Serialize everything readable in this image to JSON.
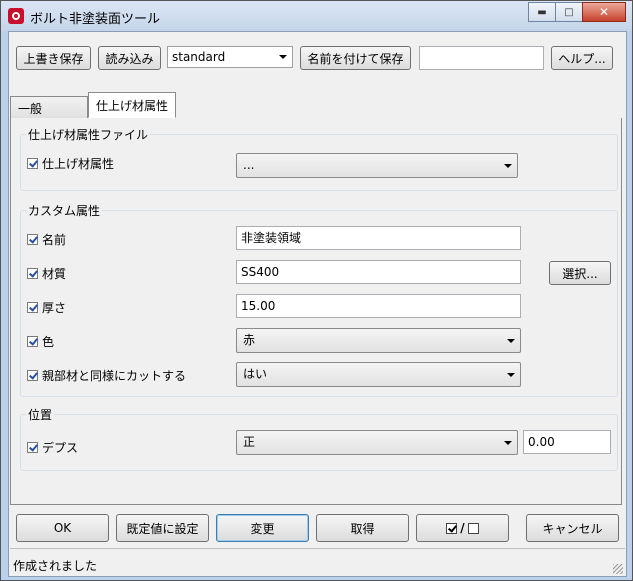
{
  "window": {
    "title": "ボルト非塗装面ツール"
  },
  "toolbar": {
    "save_label": "上書き保存",
    "load_label": "読み込み",
    "preset_value": "standard",
    "save_as_label": "名前を付けて保存",
    "save_as_name": "",
    "help_label": "ヘルプ..."
  },
  "tabs": [
    {
      "label": "一般"
    },
    {
      "label": "仕上げ材属性"
    }
  ],
  "finish_file": {
    "group_title": "仕上げ材属性ファイル",
    "label": "仕上げ材属性",
    "value": "..."
  },
  "custom": {
    "group_title": "カスタム属性",
    "name_label": "名前",
    "name_value": "非塗装領域",
    "material_label": "材質",
    "material_value": "SS400",
    "select_label": "選択...",
    "thickness_label": "厚さ",
    "thickness_value": "15.00",
    "color_label": "色",
    "color_value": "赤",
    "cut_label": "親部材と同様にカットする",
    "cut_value": "はい"
  },
  "position": {
    "group_title": "位置",
    "depth_label": "デプス",
    "depth_mode": "正",
    "depth_value": "0.00"
  },
  "bottom": {
    "ok_label": "OK",
    "default_label": "既定値に設定",
    "apply_label": "変更",
    "get_label": "取得",
    "cancel_label": "キャンセル"
  },
  "status": {
    "text": "作成されました"
  }
}
